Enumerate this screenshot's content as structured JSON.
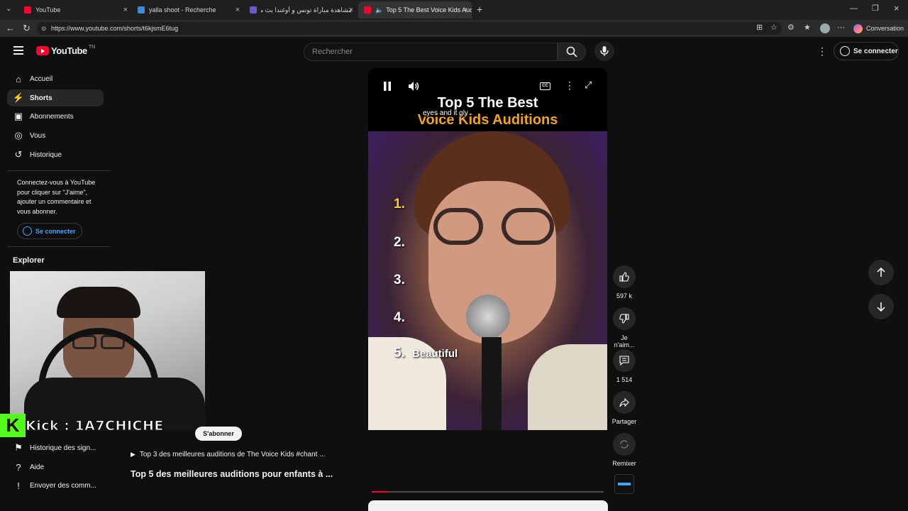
{
  "browser": {
    "tabs": [
      {
        "title": "YouTube"
      },
      {
        "title": "yalla shoot - Recherche"
      },
      {
        "title": "مشاهدة مباراة تونس و أوغندا بث مب"
      },
      {
        "title": "Top 5 The Best Voice Kids Aud"
      }
    ],
    "url": "https://www.youtube.com/shorts/t6kjsmE6tug",
    "conversation_label": "Conversation"
  },
  "youtube": {
    "logo_text": "YouTube",
    "region": "TN",
    "search_placeholder": "Rechercher",
    "signin_label": "Se connecter",
    "sidebar": {
      "items": [
        {
          "label": "Accueil"
        },
        {
          "label": "Shorts"
        },
        {
          "label": "Abonnements"
        },
        {
          "label": "Vous"
        },
        {
          "label": "Historique"
        }
      ],
      "login_prompt": "Connectez-vous à YouTube pour cliquer sur \"J'aime\", ajouter un commentaire et vous abonner.",
      "login_button": "Se connecter",
      "explore_heading": "Explorer",
      "bottom_items": [
        {
          "label": "Historique des sign..."
        },
        {
          "label": "Aide"
        },
        {
          "label": "Envoyer des comm..."
        }
      ]
    },
    "short": {
      "title_line1": "Top 5 The Best",
      "title_line2": "Voice Kids Auditions",
      "caption": "eyes and it gly",
      "rank_labels": [
        "1.",
        "2.",
        "3.",
        "4.",
        "5."
      ],
      "rank5_name": "Beautiful",
      "playlist_label": "Top 3 des meilleures auditions de The Voice Kids #chant ...",
      "video_title": "Top 5 des meilleures auditions pour enfants à ...",
      "subscribe_label": "S'abonner",
      "progress": 0.07
    },
    "actions": {
      "likes": "597 k",
      "dislike_label": "Je n'aim...",
      "comments": "1 514",
      "share_label": "Partager",
      "remix_label": "Remixer"
    },
    "overlay": {
      "streamer_text": "Kick : 1A7CHICHE"
    }
  }
}
